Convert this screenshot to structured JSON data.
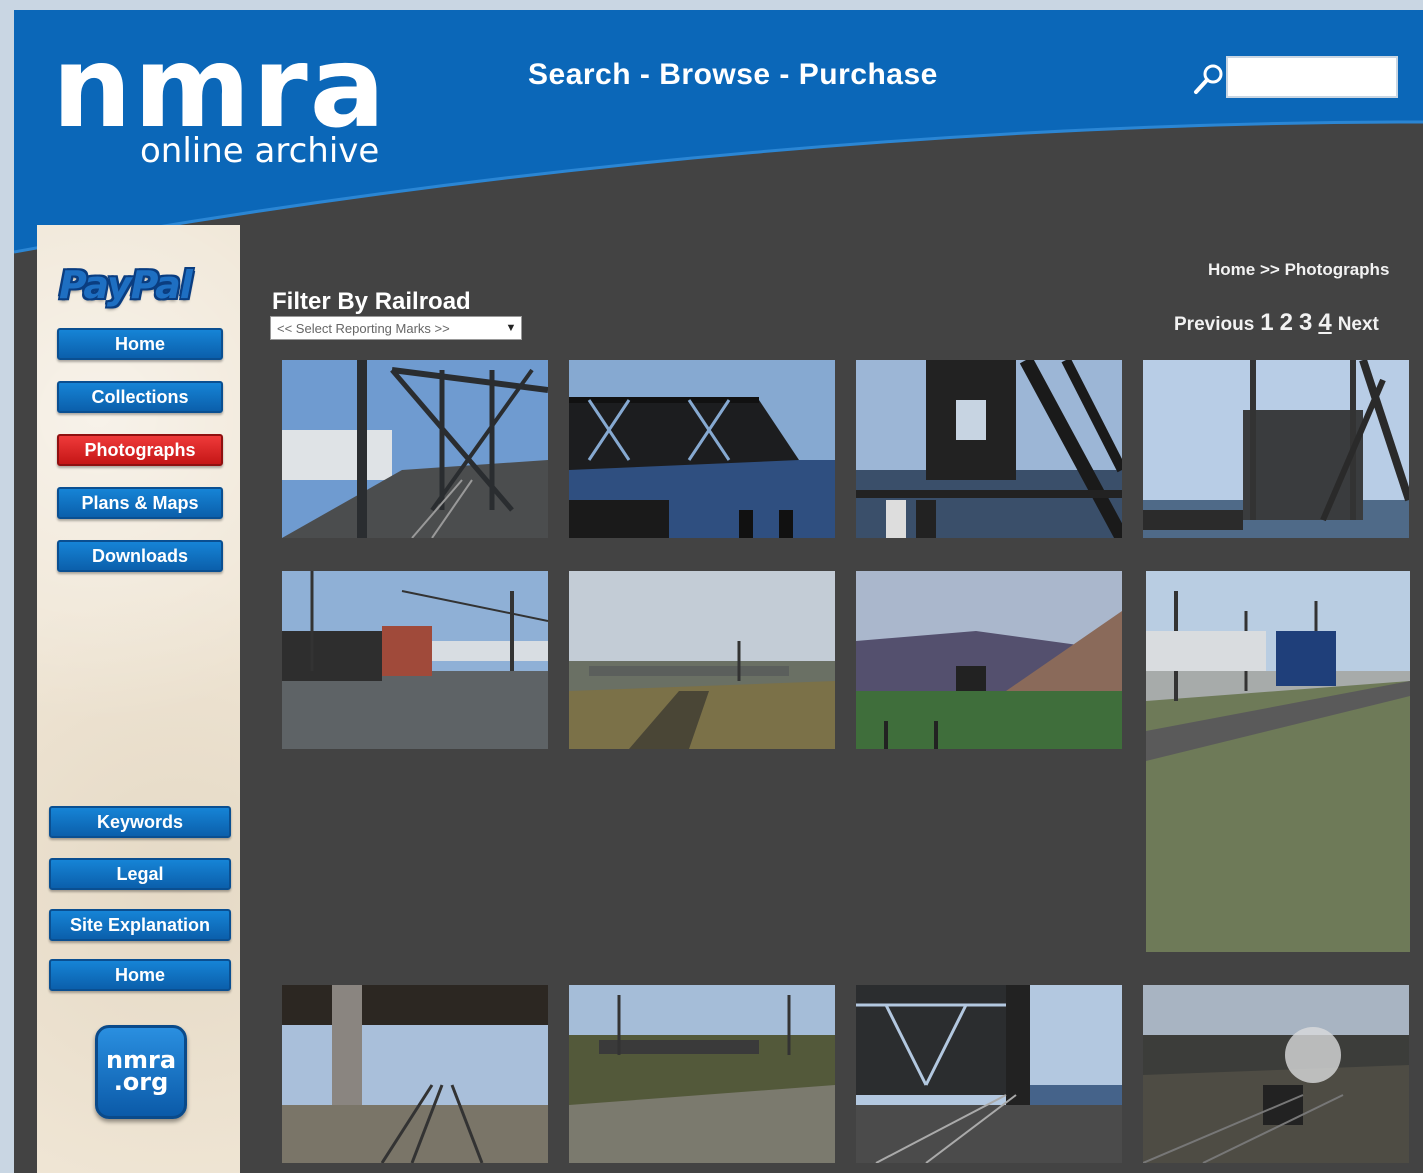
{
  "header": {
    "logo_word": "nmra",
    "logo_subtitle": "online archive",
    "tagline": "Search - Browse - Purchase",
    "search_placeholder": "",
    "brand_color": "#0b67b8"
  },
  "sidebar": {
    "paypal_label": "PayPal",
    "nav_top": [
      {
        "label": "Home",
        "active": false
      },
      {
        "label": "Collections",
        "active": false
      },
      {
        "label": "Photographs",
        "active": true
      },
      {
        "label": "Plans & Maps",
        "active": false
      },
      {
        "label": "Downloads",
        "active": false
      }
    ],
    "nav_bottom": [
      {
        "label": "Keywords"
      },
      {
        "label": "Legal"
      },
      {
        "label": "Site Explanation"
      },
      {
        "label": "Home"
      }
    ],
    "nmra_org_line1": "nmra",
    "nmra_org_line2": ".org"
  },
  "breadcrumb": {
    "home": "Home",
    "separator": ">>",
    "current": "Photographs"
  },
  "filter": {
    "title": "Filter By Railroad",
    "selected_option": "<< Select Reporting Marks >>"
  },
  "pagination": {
    "previous": "Previous",
    "pages": [
      "1",
      "2",
      "3",
      "4"
    ],
    "current_page": "4",
    "next": "Next"
  },
  "gallery": {
    "thumbnail_count": 12
  }
}
